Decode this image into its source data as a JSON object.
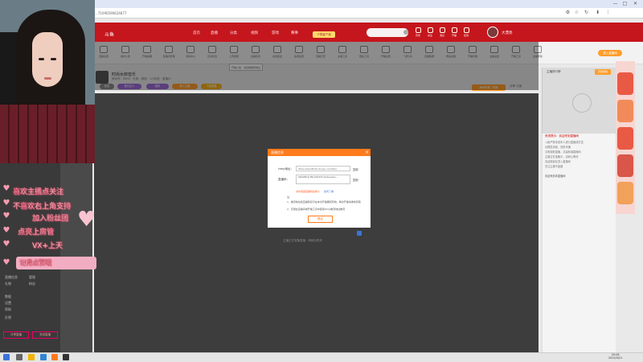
{
  "browser": {
    "url": "...71090590624877",
    "toolbar_icons": [
      "extension-icon",
      "star-icon",
      "reload-icon",
      "download-icon",
      "more-icon"
    ],
    "window_controls": [
      "—",
      "□",
      "✕"
    ]
  },
  "header": {
    "logo": "斗鱼",
    "nav": [
      "首页",
      "直播",
      "分类",
      "视频",
      "游戏",
      "赛事",
      "鱼吧"
    ],
    "search_placeholder": "",
    "badge": "下载客户端",
    "tools": [
      "历史",
      "关注",
      "消息",
      "开播",
      "签到"
    ],
    "user": "大漂亮"
  },
  "toolbar": {
    "tools": [
      "直播设置",
      "发布公告",
      "开播提醒",
      "直播间管理",
      "活动中心",
      "互动玩法",
      "上传视频",
      "主播任务",
      "在线连麦",
      "鱼塘设置",
      "直播日历",
      "主播工具",
      "更多工具",
      "开播设置",
      "一键分享",
      "直播数据",
      "粉丝勋章",
      "开播管理",
      "主播设置",
      "开播工具",
      "主播帮助"
    ],
    "entry_button": "进入直播间",
    "notice_popup": "开播公告：请复制推流地址"
  },
  "room": {
    "title": "时尚女郎音乐",
    "meta": "房间号：9890 · 分类：颜值 · 1小时前 · 直播中",
    "tags": [
      "颜值",
      "音乐达人",
      "陪伴",
      "新人主播",
      "下载直播"
    ],
    "report_button": "房间举报 | 举报",
    "actions": "分享  订阅"
  },
  "modal": {
    "title": "直播信息",
    "rtmp_label": "rtmp地址：",
    "rtmp_value": "rtmp://sendtc3a.douyu.com/live",
    "stream_label": "直播码：",
    "stream_value": "9890802rP8vbRhM7re0deeabo...",
    "copy_label": "复制",
    "hint_warning": "请勿泄露直播码给他人",
    "hint_link": "如何了解",
    "note_title": "注：",
    "note_1": "1、推流地址和直播码仅可在本次开播期间有效，每次开播请重新获取",
    "note_2": "2、仅限在直播间或开播工具中使用rtmp推流地址推流",
    "confirm": "确定"
  },
  "player": {
    "footer": "主播正在准备直播 · 请稍后再来"
  },
  "right_panel": {
    "tab": "主播排行榜",
    "rank_button": "贡献周榜",
    "chat_red": "系统提示：欢迎来到直播间",
    "chat_lines": [
      "斗鱼严禁未成年人进行直播或打赏",
      "请理性消费，谨防诈骗",
      "文明观看直播，共建和谐直播间",
      "主播正在准备中，请耐心等待",
      "欢迎新朋友进入直播间",
      "关注主播不迷路"
    ],
    "chat_bottom": "欢迎来到本直播间"
  },
  "stickers": [
    {
      "text": "喜欢主播点关注"
    },
    {
      "text": "不喜欢右上角支持"
    },
    {
      "text": "加入粉丝团"
    },
    {
      "text": "点亮上房管"
    },
    {
      "text": "VX+上天"
    },
    {
      "text": "记得点赞哦"
    }
  ],
  "left_panel": {
    "rows": [
      "直播信息",
      "管理",
      "礼物",
      "粉丝",
      "数据",
      "设置",
      "帮助",
      "反馈"
    ],
    "buttons": [
      "分享直播",
      "关闭直播"
    ]
  },
  "taskbar": {
    "time": "20:06",
    "date": "2022/3/21",
    "apps": [
      "start-icon",
      "search-icon",
      "explorer-icon",
      "edge-icon",
      "douyu-icon",
      "obs-icon"
    ]
  },
  "colors": {
    "brand_red": "#c5161d",
    "modal_orange": "#ff7b1c",
    "sticker_pink": "#f3adc2"
  }
}
